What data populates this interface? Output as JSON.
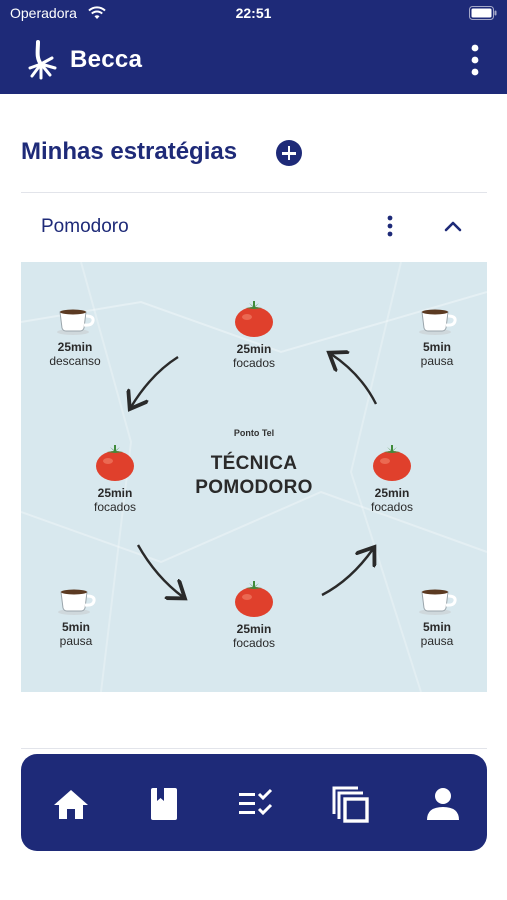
{
  "status_bar": {
    "carrier": "Operadora",
    "time": "22:51"
  },
  "app_bar": {
    "title": "Becca"
  },
  "strategies": {
    "heading": "Minhas estratégias",
    "items": [
      {
        "name": "Pomodoro",
        "expanded": true
      }
    ]
  },
  "infographic": {
    "brand": "Ponto Tel",
    "title_line1": "TÉCNICA",
    "title_line2": "POMODORO",
    "steps": [
      {
        "icon": "coffee-cup-icon",
        "duration": "25min",
        "activity": "descanso"
      },
      {
        "icon": "tomato-icon",
        "duration": "25min",
        "activity": "focados"
      },
      {
        "icon": "coffee-cup-icon",
        "duration": "5min",
        "activity": "pausa"
      },
      {
        "icon": "tomato-icon",
        "duration": "25min",
        "activity": "focados"
      },
      {
        "icon": "tomato-icon",
        "duration": "25min",
        "activity": "focados"
      },
      {
        "icon": "coffee-cup-icon",
        "duration": "5min",
        "activity": "pausa"
      },
      {
        "icon": "tomato-icon",
        "duration": "25min",
        "activity": "focados"
      },
      {
        "icon": "coffee-cup-icon",
        "duration": "5min",
        "activity": "pausa"
      }
    ]
  },
  "bottom_nav": {
    "items": [
      "home-icon",
      "book-icon",
      "checklist-icon",
      "copy-icon",
      "profile-icon"
    ]
  },
  "colors": {
    "primary": "#1e2a78",
    "infographic_bg": "#d8e8ee",
    "tomato": "#e0402c"
  }
}
